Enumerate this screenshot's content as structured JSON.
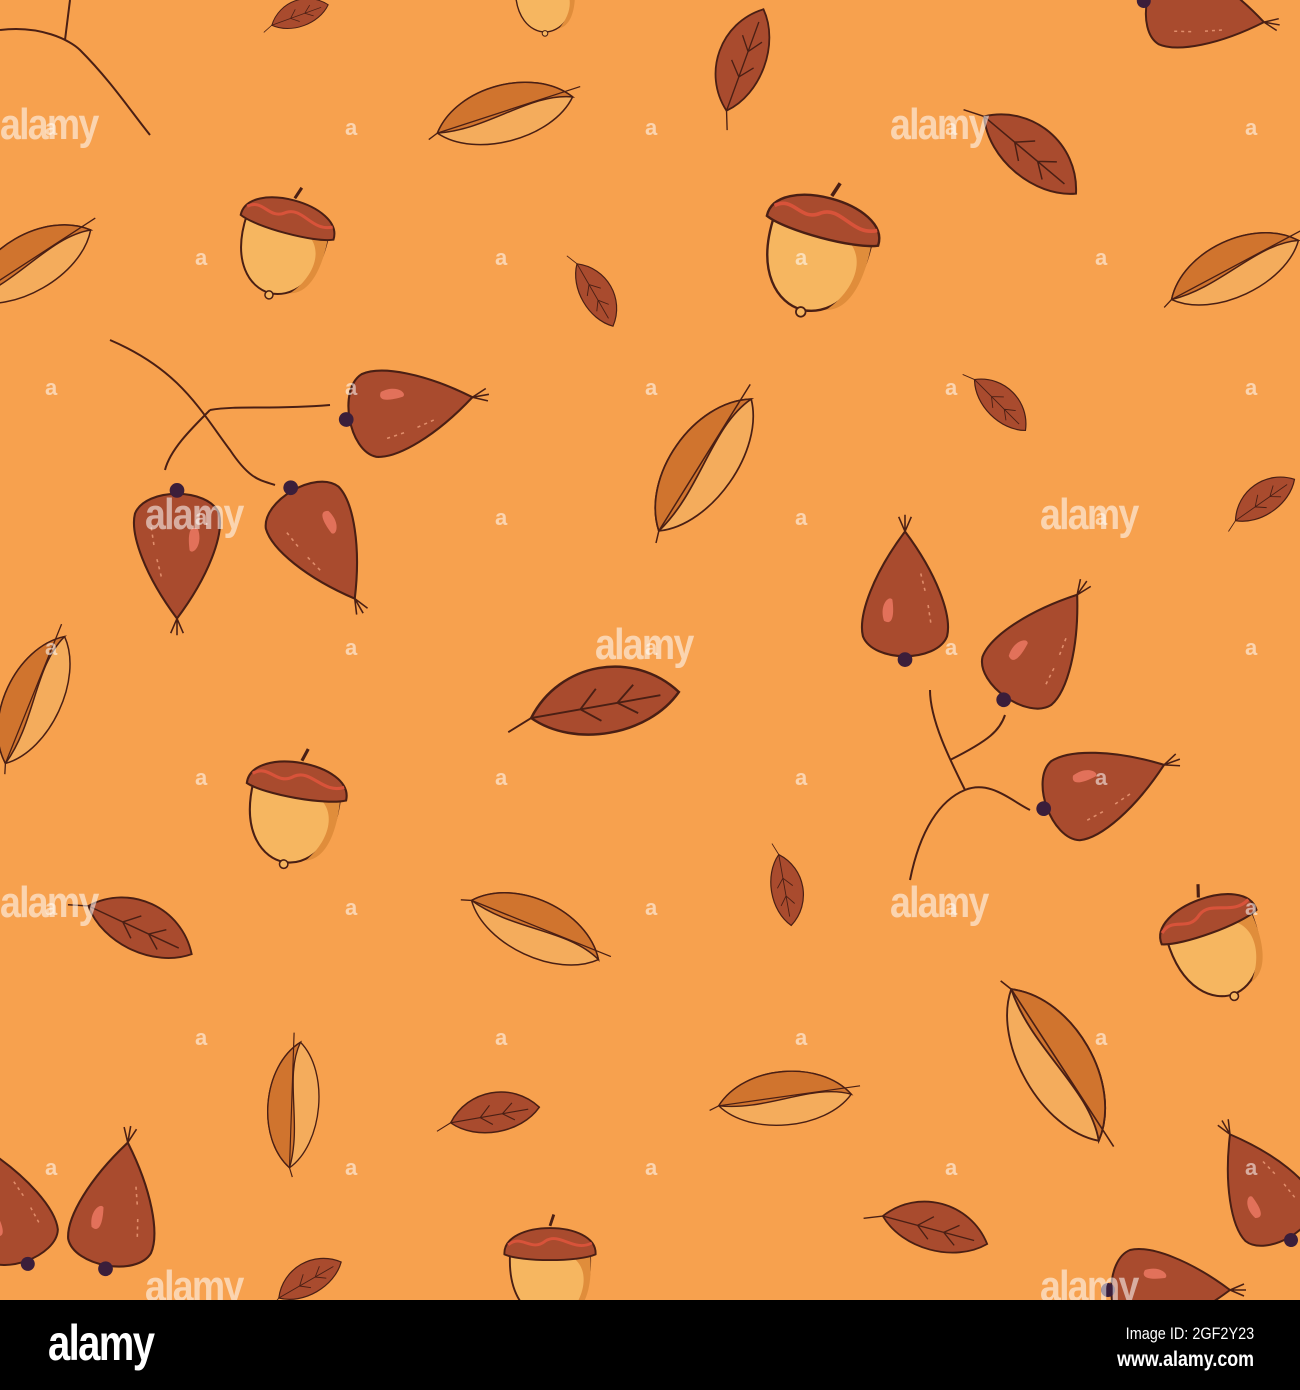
{
  "pattern": {
    "watermark_text": "alamy",
    "watermark_mark": "a",
    "colors": {
      "background": "#F7A14E",
      "dark_leaf": "#A94B2E",
      "light_leaf": "#F4AC5C",
      "light_leaf_shade": "#D0742E",
      "outline": "#4A1F14",
      "acorn_body": "#F6B660",
      "acorn_cap": "#A94B2E"
    }
  },
  "footer": {
    "logo": "alamy",
    "image_id": "Image ID: 2GF2Y23",
    "url": "www.alamy.com"
  }
}
